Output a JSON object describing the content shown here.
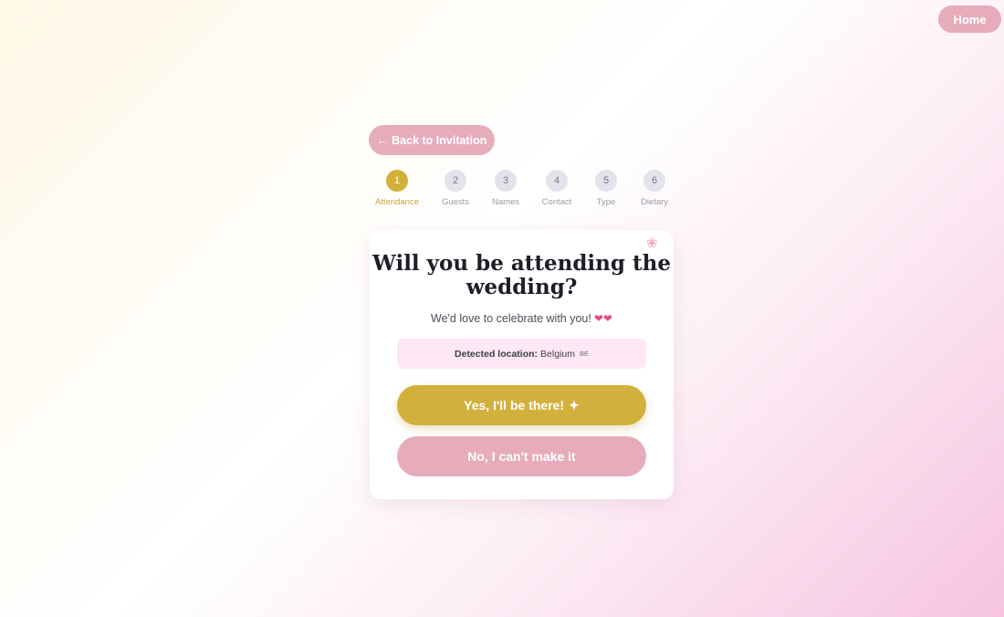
{
  "header": {
    "home_label": "Home"
  },
  "back_button": {
    "arrow": "←",
    "label": "Back to Invitation"
  },
  "steps": [
    {
      "number": "1",
      "label": "Attendance",
      "active": true
    },
    {
      "number": "2",
      "label": "Guests",
      "active": false
    },
    {
      "number": "3",
      "label": "Names",
      "active": false
    },
    {
      "number": "4",
      "label": "Contact",
      "active": false
    },
    {
      "number": "5",
      "label": "Type",
      "active": false
    },
    {
      "number": "6",
      "label": "Dietary",
      "active": false
    }
  ],
  "card": {
    "decor_icon": "❀",
    "title": "Will you be attending the wedding?",
    "subtitle": "We'd love to celebrate with you!",
    "subtitle_icon": "❤❤",
    "location_label": "Detected location:",
    "location_value": "Belgium",
    "location_code": "BE",
    "yes_label": "Yes, I'll be there!",
    "yes_icon": "✦",
    "no_label": "No, I can't make it"
  },
  "colors": {
    "accent_gold": "#d2b03c",
    "accent_pink": "#e6acbc",
    "location_bg": "#fde8f3"
  }
}
